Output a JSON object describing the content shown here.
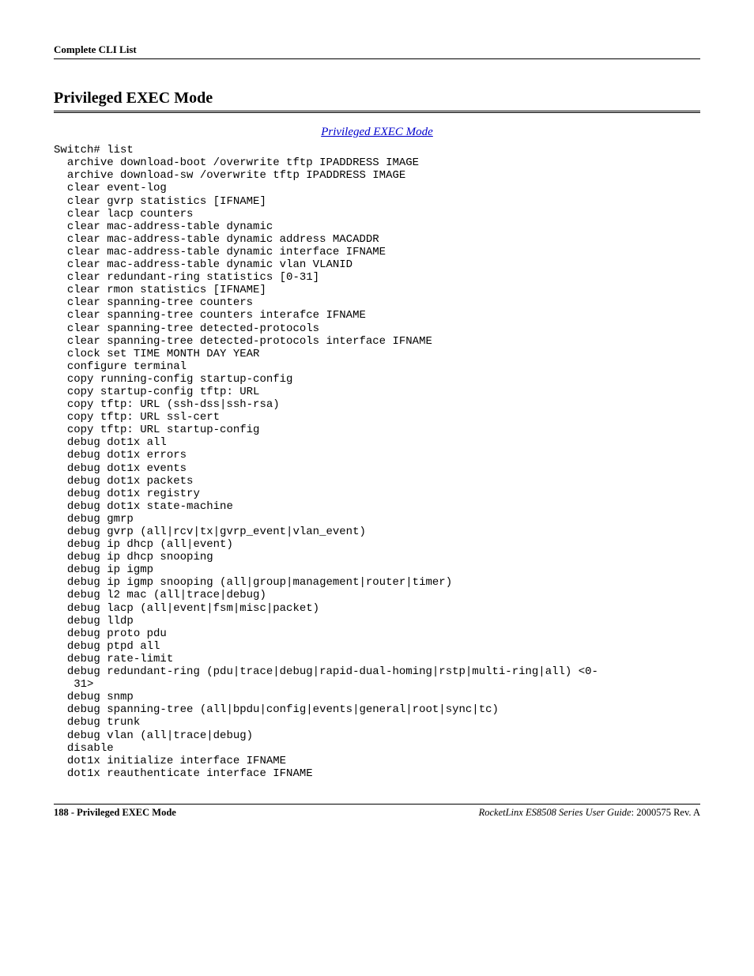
{
  "running_head": "Complete CLI List",
  "section_title": "Privileged EXEC Mode",
  "xref_label": "Privileged EXEC Mode",
  "cli_block": "Switch# list\n  archive download-boot /overwrite tftp IPADDRESS IMAGE\n  archive download-sw /overwrite tftp IPADDRESS IMAGE\n  clear event-log\n  clear gvrp statistics [IFNAME]\n  clear lacp counters\n  clear mac-address-table dynamic\n  clear mac-address-table dynamic address MACADDR\n  clear mac-address-table dynamic interface IFNAME\n  clear mac-address-table dynamic vlan VLANID\n  clear redundant-ring statistics [0-31]\n  clear rmon statistics [IFNAME]\n  clear spanning-tree counters\n  clear spanning-tree counters interafce IFNAME\n  clear spanning-tree detected-protocols\n  clear spanning-tree detected-protocols interface IFNAME\n  clock set TIME MONTH DAY YEAR\n  configure terminal\n  copy running-config startup-config\n  copy startup-config tftp: URL\n  copy tftp: URL (ssh-dss|ssh-rsa)\n  copy tftp: URL ssl-cert\n  copy tftp: URL startup-config\n  debug dot1x all\n  debug dot1x errors\n  debug dot1x events\n  debug dot1x packets\n  debug dot1x registry\n  debug dot1x state-machine\n  debug gmrp\n  debug gvrp (all|rcv|tx|gvrp_event|vlan_event)\n  debug ip dhcp (all|event)\n  debug ip dhcp snooping\n  debug ip igmp\n  debug ip igmp snooping (all|group|management|router|timer)\n  debug l2 mac (all|trace|debug)\n  debug lacp (all|event|fsm|misc|packet)\n  debug lldp\n  debug proto pdu\n  debug ptpd all\n  debug rate-limit\n  debug redundant-ring (pdu|trace|debug|rapid-dual-homing|rstp|multi-ring|all) <0-\n   31>\n  debug snmp\n  debug spanning-tree (all|bpdu|config|events|general|root|sync|tc)\n  debug trunk\n  debug vlan (all|trace|debug)\n  disable\n  dot1x initialize interface IFNAME\n  dot1x reauthenticate interface IFNAME",
  "footer": {
    "left": "188 - Privileged EXEC Mode",
    "right_italic": "RocketLinx ES8508 Series  User Guide",
    "right_rev": ": 2000575 Rev. A"
  }
}
